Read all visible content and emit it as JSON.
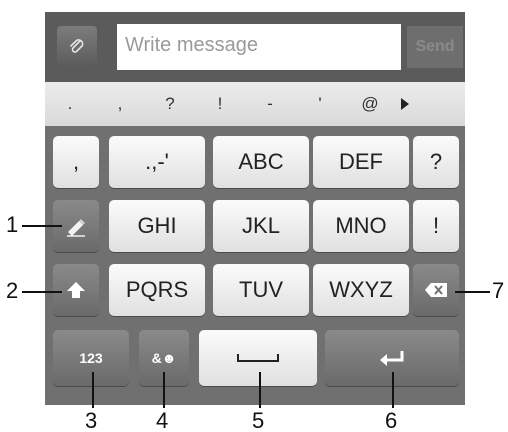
{
  "compose": {
    "placeholder": "Write message",
    "send_label": "Send",
    "attach_icon": "paperclip-icon"
  },
  "suggestions": [
    ".",
    ",",
    "?",
    "!",
    "-",
    "'",
    "@"
  ],
  "keys": {
    "row1": [
      ",",
      ".,-'",
      "ABC",
      "DEF",
      "?"
    ],
    "row2": [
      "GHI",
      "JKL",
      "MNO",
      "!"
    ],
    "row3": [
      "PQRS",
      "TUV",
      "WXYZ"
    ],
    "numbers_label": "123",
    "emoji_label": "&☻"
  },
  "callouts": [
    "1",
    "2",
    "3",
    "4",
    "5",
    "6",
    "7"
  ]
}
